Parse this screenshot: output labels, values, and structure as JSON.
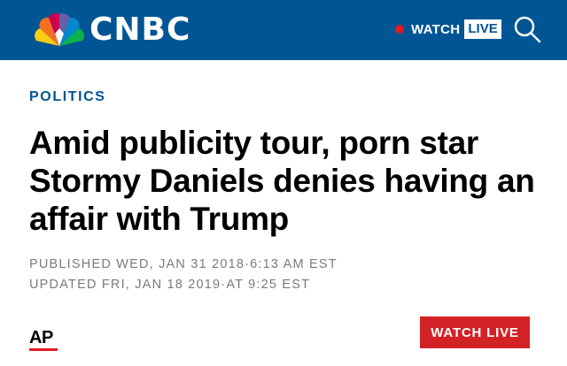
{
  "header": {
    "brand": "CNBC",
    "watch_label": "WATCH",
    "live_label": "LIVE",
    "icons": [
      "peacock-logo-icon",
      "search-icon"
    ],
    "colors": {
      "header_bg": "#005594",
      "live_dot": "#e31b23"
    }
  },
  "article": {
    "section": "POLITICS",
    "headline": "Amid publicity tour, porn star Stormy Daniels denies having an affair with Trump",
    "published": "PUBLISHED WED, JAN 31 2018·6:13 AM EST",
    "updated": "UPDATED FRI, JAN 18 2019·AT 9:25 EST",
    "source_logo": "AP"
  },
  "footer": {
    "watch_live_button": "WATCH LIVE",
    "colors": {
      "button_bg": "#d32226"
    }
  }
}
